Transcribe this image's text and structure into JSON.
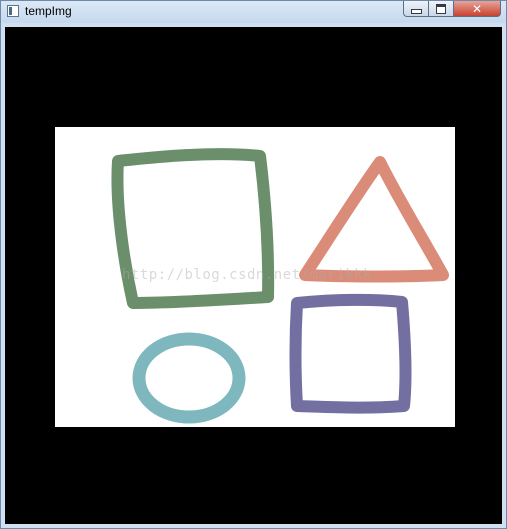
{
  "window": {
    "title": "tempImg",
    "controls": {
      "minimize_icon": "minimize-icon",
      "maximize_icon": "maximize-icon",
      "close_icon": "close-icon",
      "close_glyph": "✕"
    },
    "close_color": "#c8422f"
  },
  "canvas": {
    "background": "#000000",
    "image_background": "#ffffff",
    "watermark": "http://blog.csdn.net/marikkk",
    "shapes": [
      {
        "name": "green-square-shape",
        "kind": "rectangle",
        "color": "#6b8f6b"
      },
      {
        "name": "salmon-triangle-shape",
        "kind": "triangle",
        "color": "#db8c78"
      },
      {
        "name": "teal-ellipse-shape",
        "kind": "ellipse",
        "color": "#7eb8be"
      },
      {
        "name": "purple-square-shape",
        "kind": "rectangle",
        "color": "#736fa0"
      }
    ]
  }
}
